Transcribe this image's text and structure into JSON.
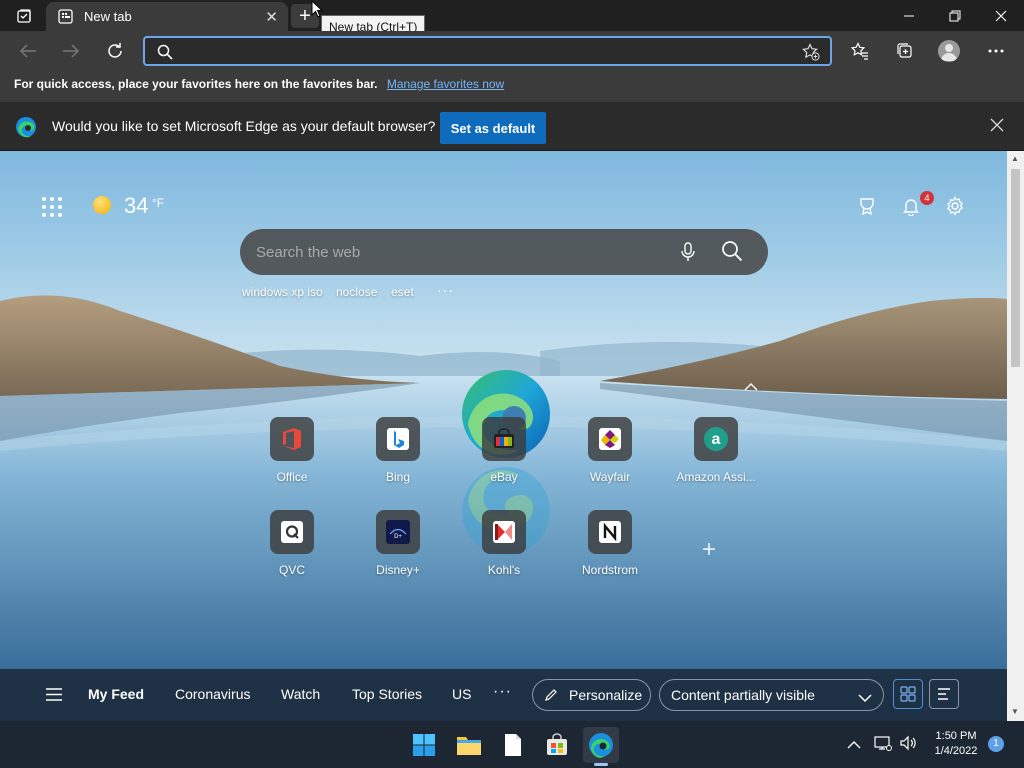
{
  "browser": {
    "tab_title": "New tab",
    "newtab_tooltip": "New tab (Ctrl+T)",
    "address_value": "",
    "favorites_bar": {
      "text": "For quick access, place your favorites here on the favorites bar.",
      "link": "Manage favorites now"
    },
    "banner": {
      "message": "Would you like to set Microsoft Edge as your default browser?",
      "button": "Set as default"
    }
  },
  "ntp": {
    "weather": {
      "temp": "34",
      "unit": "°F"
    },
    "notification_count": "4",
    "search_placeholder": "Search the web",
    "recent_searches": [
      "windows xp iso",
      "noclose",
      "eset"
    ],
    "quick_links": [
      {
        "label": "Office",
        "icon": "office-icon"
      },
      {
        "label": "Bing",
        "icon": "bing-icon"
      },
      {
        "label": "eBay",
        "icon": "ebay-icon"
      },
      {
        "label": "Wayfair",
        "icon": "wayfair-icon"
      },
      {
        "label": "Amazon Assi...",
        "icon": "amazon-assistant-icon"
      },
      {
        "label": "QVC",
        "icon": "qvc-icon"
      },
      {
        "label": "Disney+",
        "icon": "disney-plus-icon"
      },
      {
        "label": "Kohl's",
        "icon": "kohls-icon"
      },
      {
        "label": "Nordstrom",
        "icon": "nordstrom-icon"
      }
    ],
    "feed": {
      "tabs": [
        "My Feed",
        "Coronavirus",
        "Watch",
        "Top Stories",
        "US"
      ],
      "personalize": "Personalize",
      "content_visibility": "Content partially visible"
    }
  },
  "taskbar": {
    "time": "1:50 PM",
    "date": "1/4/2022",
    "notification_count": "1"
  },
  "colors": {
    "accent_blue": "#0f6cbd",
    "link_blue": "#75b6f7",
    "badge_red": "#d13438"
  }
}
